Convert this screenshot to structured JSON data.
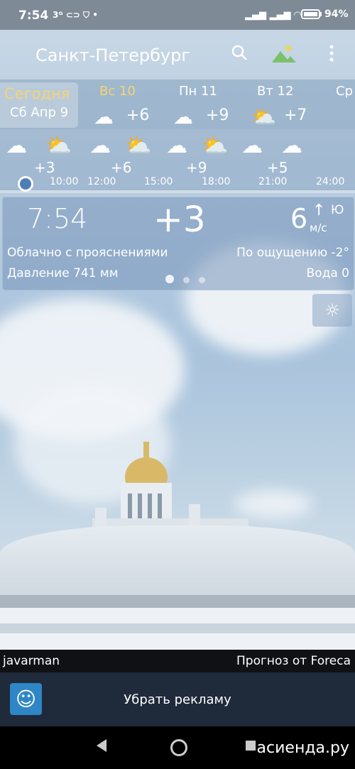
{
  "status": {
    "time": "7:54",
    "battery": "94%"
  },
  "toolbar": {
    "city": "Санкт-Петербург"
  },
  "days": [
    {
      "label": "Сегодня",
      "sub": "Сб Апр 9",
      "temp": ""
    },
    {
      "label": "Вс 10",
      "temp": "+6"
    },
    {
      "label": "Пн 11",
      "temp": "+9"
    },
    {
      "label": "Вт 12",
      "temp": "+7"
    },
    {
      "label": "Ср",
      "temp": ""
    }
  ],
  "hourly": {
    "temps": [
      "+3",
      "+6",
      "+9",
      "+5"
    ],
    "times": [
      "10:00",
      "12:00",
      "15:00",
      "18:00",
      "21:00",
      "24:00"
    ]
  },
  "current": {
    "time": "7:54",
    "temp": "+3",
    "wind_speed": "6",
    "wind_dir": "Ю",
    "wind_unit": "м/с",
    "condition": "Облачно с прояснениями",
    "feels": "По ощущению -2°",
    "pressure": "Давление 741 мм",
    "water": "Вода 0"
  },
  "credit": {
    "author": "javarman",
    "provider": "Прогноз от Foreca"
  },
  "ad": {
    "label": "Убрать рекламу"
  },
  "watermark": "асиенда.ру"
}
